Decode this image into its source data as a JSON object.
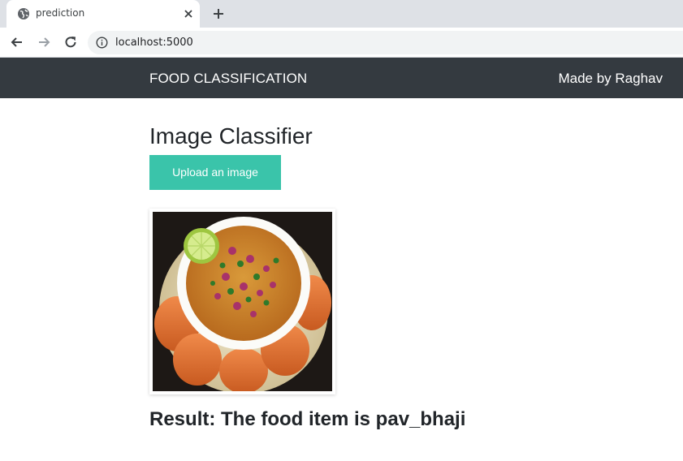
{
  "browser": {
    "tab_title": "prediction",
    "url": "localhost:5000"
  },
  "navbar": {
    "brand": "FOOD CLASSIFICATION",
    "author": "Made by Raghav"
  },
  "main": {
    "title": "Image Classifier",
    "upload_label": "Upload an image",
    "result_text": "Result: The food item is pav_bhaji"
  },
  "colors": {
    "navbar_bg": "#343a40",
    "upload_button": "#3ac4aa"
  },
  "icons": [
    "globe-icon",
    "close-icon",
    "plus-icon",
    "back-arrow-icon",
    "forward-arrow-icon",
    "reload-icon",
    "info-icon"
  ]
}
